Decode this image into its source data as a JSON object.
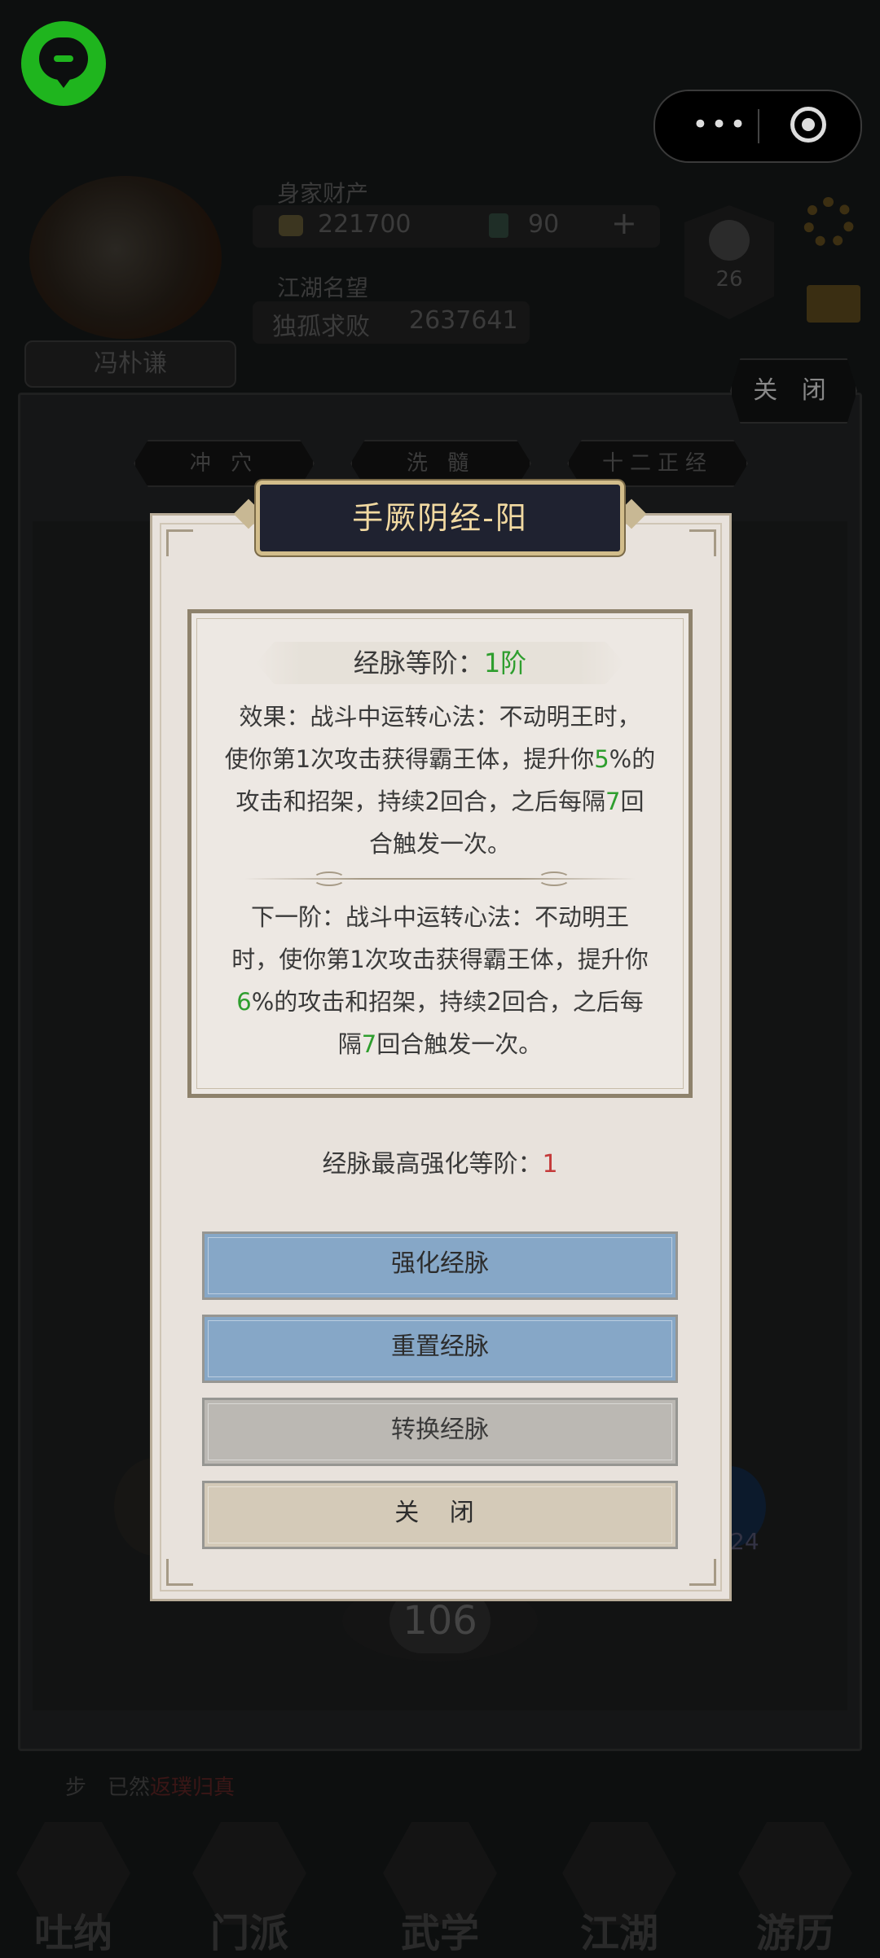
{
  "capsule": {
    "more_icon": "more-dots-icon",
    "close_icon": "target-circle-icon"
  },
  "header": {
    "wealth_label": "身家财产",
    "gold": "221700",
    "jade": "90",
    "plus": "+",
    "fame_label": "江湖名望",
    "fame_title": "独孤求败",
    "fame_value": "2637641",
    "player_name": "冯朴谦",
    "badge_level": "26"
  },
  "panel": {
    "close_label": "关 闭",
    "tabs": [
      "冲 穴",
      "洗 髓",
      "十二正经"
    ],
    "bg_level": "106",
    "bg_right_num": "24",
    "ticker_prefix": "步",
    "ticker_text": "已然",
    "ticker_red": "返璞归真"
  },
  "bottom_nav": [
    "吐纳",
    "门派",
    "武学",
    "江湖",
    "游历"
  ],
  "dialog": {
    "title": "手厥阴经-阳",
    "rank_label": "经脉等阶：",
    "rank_value": "1阶",
    "effect": {
      "p1": "效果：战斗中运转心法：不动明王时，",
      "p2a": "使你第1次攻击获得霸王体，提升你",
      "p2n": "5",
      "p2b": "%的",
      "p3a": "攻击和招架，持续2回合，之后每隔",
      "p3n": "7",
      "p3b": "回",
      "p4": "合触发一次。"
    },
    "next": {
      "p1": "下一阶：战斗中运转心法：不动明王",
      "p2": "时，使你第1次攻击获得霸王体，提升你",
      "p3n": "6",
      "p3b": "%的攻击和招架，持续2回合，之后每",
      "p4a": "隔",
      "p4n": "7",
      "p4b": "回合触发一次。"
    },
    "max_rank_label": "经脉最高强化等阶：",
    "max_rank_value": "1",
    "buttons": {
      "strengthen": "强化经脉",
      "reset": "重置经脉",
      "convert": "转换经脉",
      "close": "关 闭"
    }
  },
  "colors": {
    "accent_green": "#2e9e2e",
    "accent_red": "#c43a3a",
    "button_blue": "#86a7c7",
    "title_gold": "#f1d9a1"
  }
}
